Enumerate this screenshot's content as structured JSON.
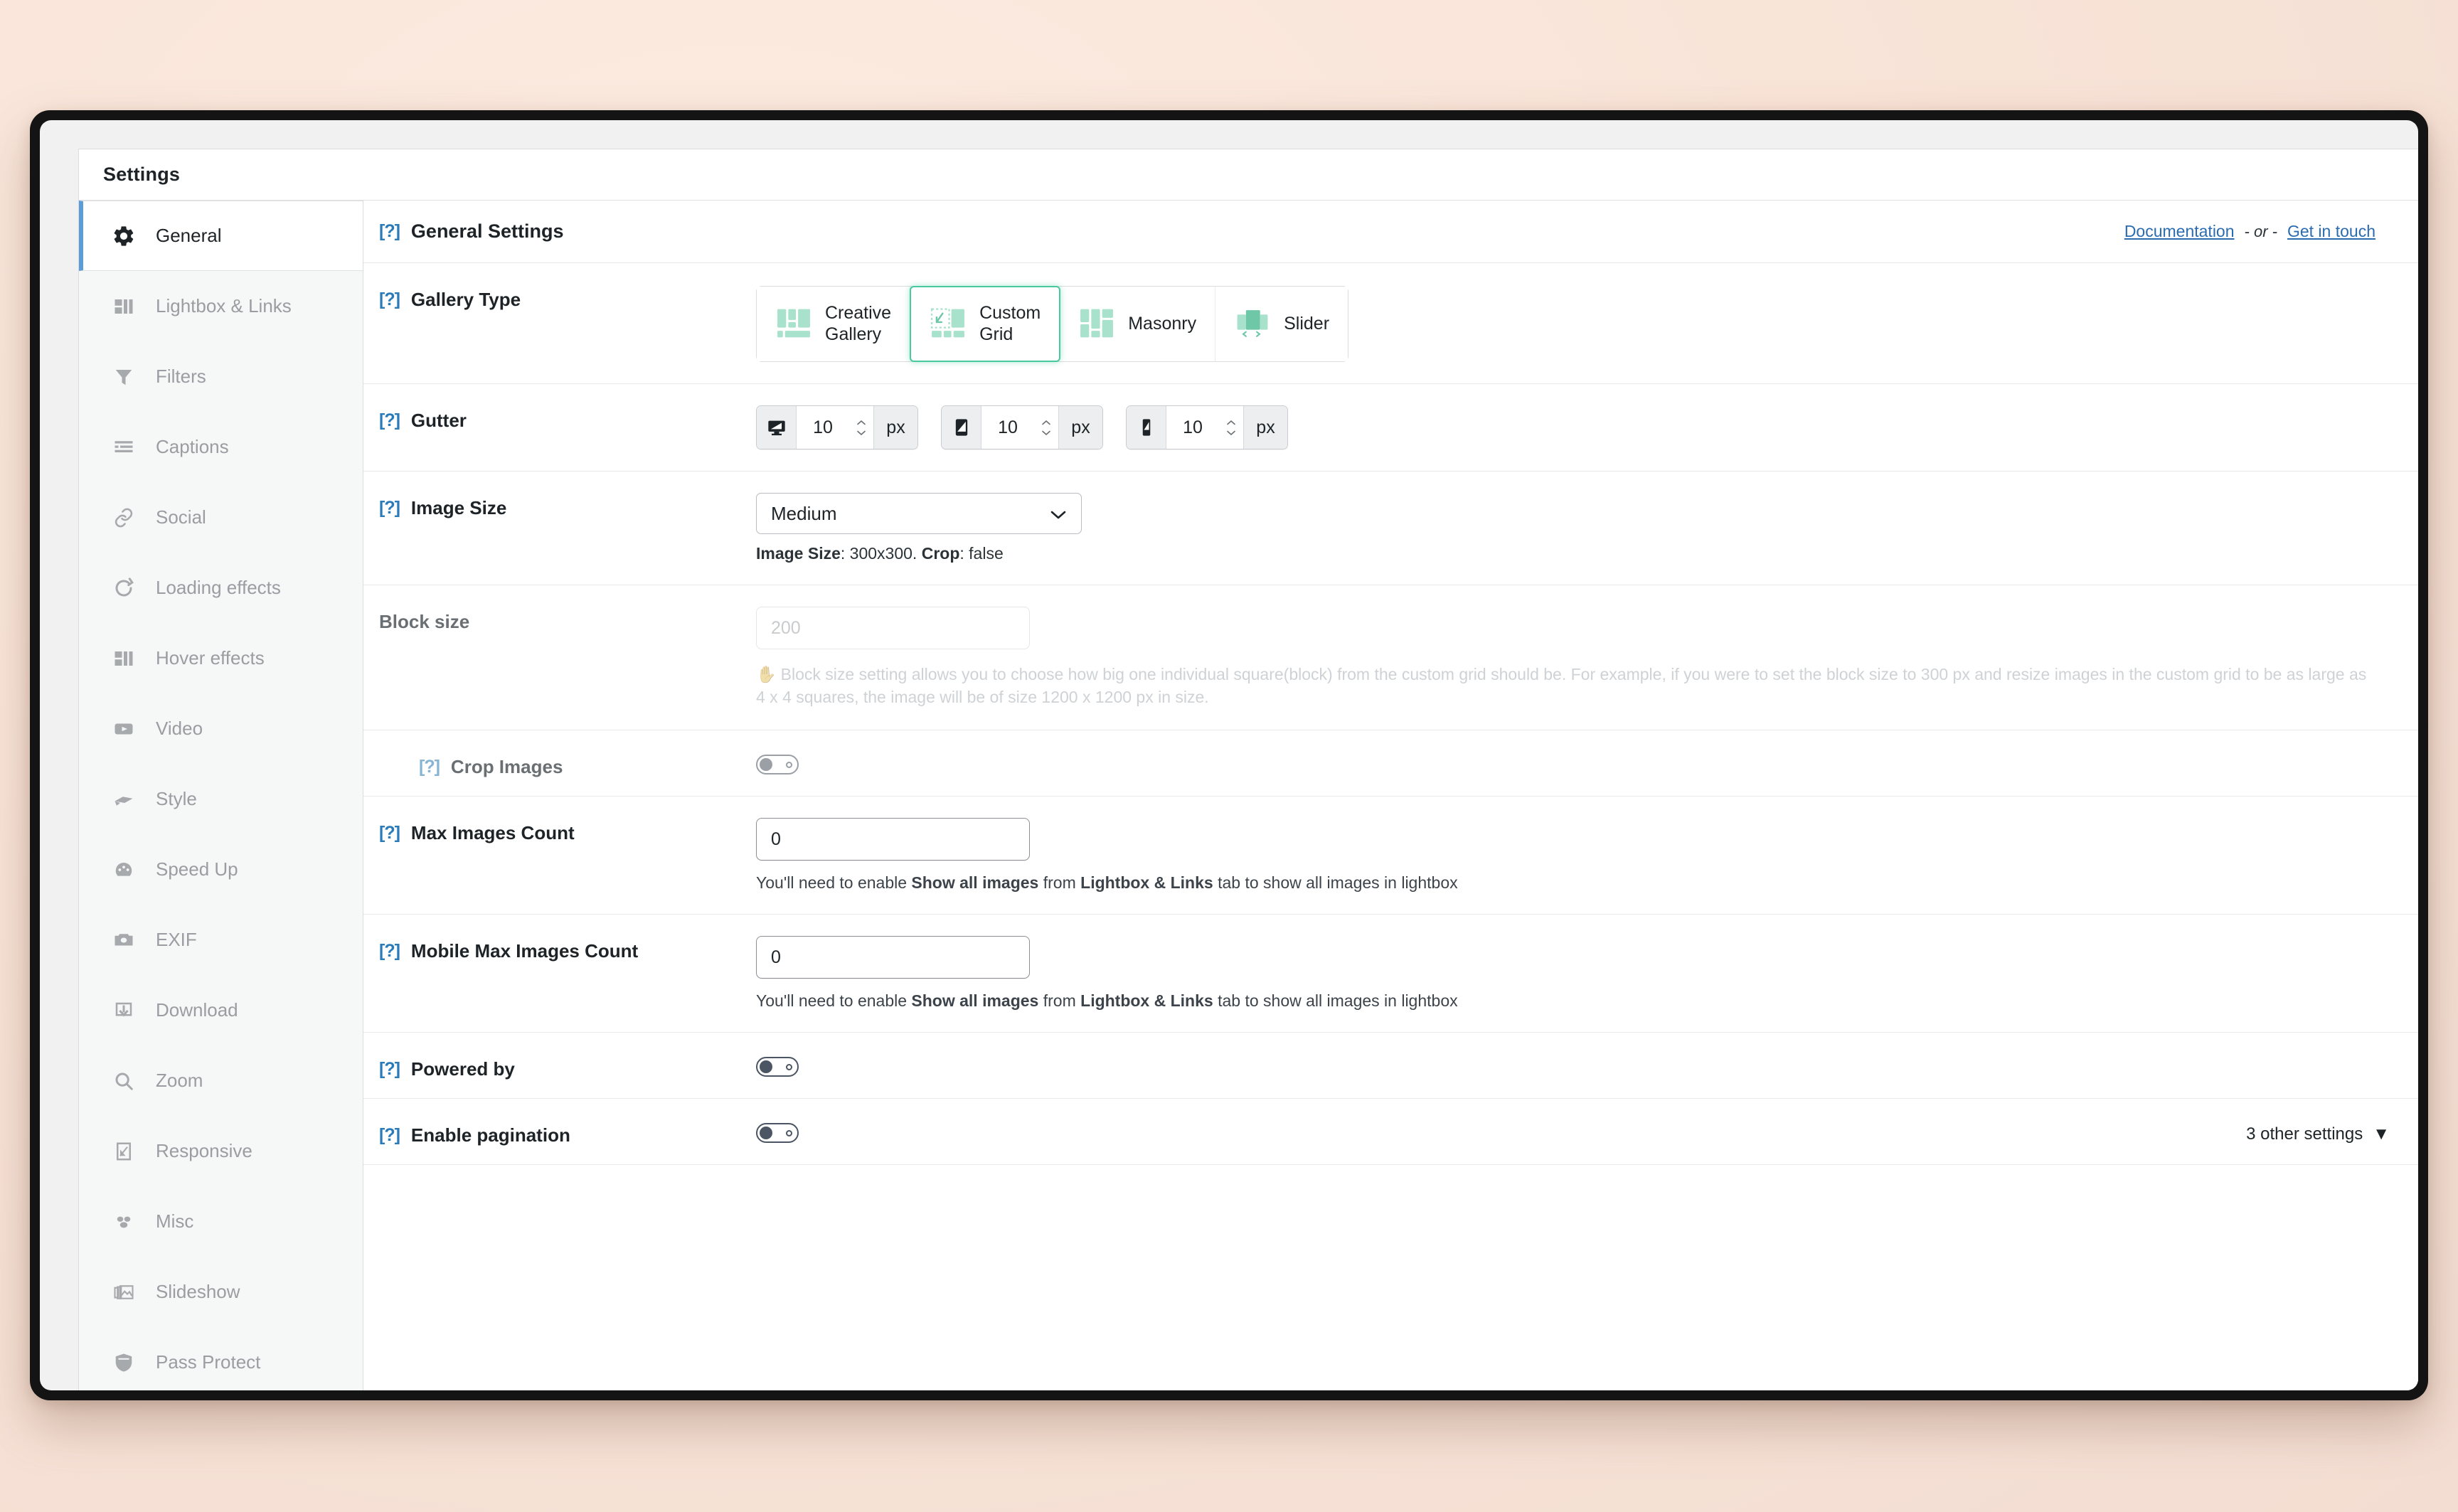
{
  "window": {
    "panel_title": "Settings"
  },
  "sidebar": {
    "items": [
      {
        "label": "General",
        "icon": "gear-icon",
        "active": true
      },
      {
        "label": "Lightbox & Links",
        "icon": "layout-icon",
        "active": false
      },
      {
        "label": "Filters",
        "icon": "funnel-icon",
        "active": false
      },
      {
        "label": "Captions",
        "icon": "text-lines-icon",
        "active": false
      },
      {
        "label": "Social",
        "icon": "link-icon",
        "active": false
      },
      {
        "label": "Loading effects",
        "icon": "refresh-icon",
        "active": false
      },
      {
        "label": "Hover effects",
        "icon": "layout-icon",
        "active": false
      },
      {
        "label": "Video",
        "icon": "video-icon",
        "active": false
      },
      {
        "label": "Style",
        "icon": "brush-icon",
        "active": false
      },
      {
        "label": "Speed Up",
        "icon": "gauge-icon",
        "active": false
      },
      {
        "label": "EXIF",
        "icon": "camera-icon",
        "active": false
      },
      {
        "label": "Download",
        "icon": "download-icon",
        "active": false
      },
      {
        "label": "Zoom",
        "icon": "magnifier-icon",
        "active": false
      },
      {
        "label": "Responsive",
        "icon": "responsive-icon",
        "active": false
      },
      {
        "label": "Misc",
        "icon": "dots-icon",
        "active": false
      },
      {
        "label": "Slideshow",
        "icon": "slideshow-icon",
        "active": false
      },
      {
        "label": "Pass Protect",
        "icon": "shield-icon",
        "active": false
      }
    ]
  },
  "header": {
    "help_marker": "[?]",
    "title": "General Settings",
    "documentation_link": "Documentation",
    "separator": "- or -",
    "contact_link": "Get in touch"
  },
  "gallery_type": {
    "help_marker": "[?]",
    "label": "Gallery Type",
    "selected": "Custom Grid",
    "options": [
      {
        "label_line1": "Creative",
        "label_line2": "Gallery",
        "icon": "creative-gallery-icon"
      },
      {
        "label_line1": "Custom",
        "label_line2": "Grid",
        "icon": "custom-grid-icon"
      },
      {
        "label_line1": "Masonry",
        "label_line2": "",
        "icon": "masonry-icon"
      },
      {
        "label_line1": "Slider",
        "label_line2": "",
        "icon": "slider-icon"
      }
    ]
  },
  "gutter": {
    "help_marker": "[?]",
    "label": "Gutter",
    "fields": [
      {
        "device": "desktop",
        "value": "10",
        "unit": "px"
      },
      {
        "device": "tablet",
        "value": "10",
        "unit": "px"
      },
      {
        "device": "mobile",
        "value": "10",
        "unit": "px"
      }
    ]
  },
  "image_size": {
    "help_marker": "[?]",
    "label": "Image Size",
    "selected": "Medium",
    "note_prefix": "Image Size",
    "note_value": ": 300x300. ",
    "note_crop_label": "Crop",
    "note_crop_value": ": false"
  },
  "block_size": {
    "label": "Block size",
    "placeholder": "200",
    "value": "",
    "help_text": "Block size setting allows you to choose how big one individual square(block) from the custom grid should be. For example, if you were to set the block size to 300 px and resize images in the custom grid to be as large as 4 x 4 squares, the image will be of size 1200 x 1200 px in size.",
    "help_icon": "raised-hand-icon"
  },
  "crop_images": {
    "help_marker": "[?]",
    "label": "Crop Images",
    "toggle_state": "off",
    "toggle_style": "light"
  },
  "max_images_count": {
    "help_marker": "[?]",
    "label": "Max Images Count",
    "value": "0",
    "note_a": "You'll need to enable ",
    "note_b": "Show all images",
    "note_c": " from ",
    "note_d": "Lightbox & Links",
    "note_e": " tab to show all images in lightbox"
  },
  "mobile_max_images_count": {
    "help_marker": "[?]",
    "label": "Mobile Max Images Count",
    "value": "0",
    "note_a": "You'll need to enable ",
    "note_b": "Show all images",
    "note_c": " from ",
    "note_d": "Lightbox & Links",
    "note_e": " tab to show all images in lightbox"
  },
  "powered_by": {
    "help_marker": "[?]",
    "label": "Powered by",
    "toggle_state": "off",
    "toggle_style": "dark"
  },
  "enable_pagination": {
    "help_marker": "[?]",
    "label": "Enable pagination",
    "toggle_state": "off",
    "toggle_style": "dark",
    "other_settings_label": "3 other settings",
    "chevron": "▼"
  },
  "colors": {
    "accent_green": "#48c9a0",
    "accent_blue": "#2b7bb9",
    "link_blue": "#2b6cb0",
    "active_bar": "#5b9dd9",
    "page_bg": "#f6e3d8"
  }
}
